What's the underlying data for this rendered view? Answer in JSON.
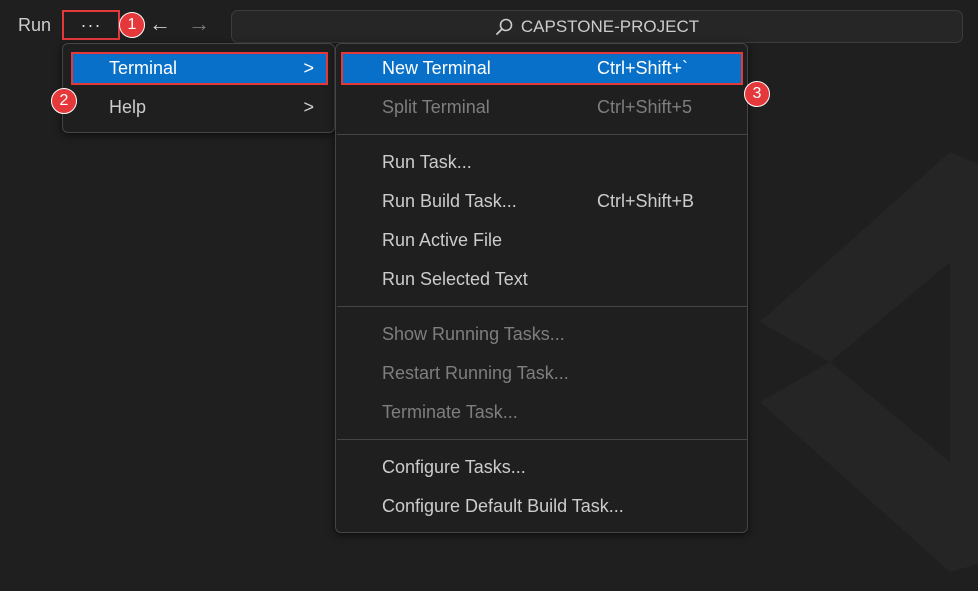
{
  "titlebar": {
    "menu_label": "Run",
    "more_label": "···",
    "back_icon": "←",
    "forward_icon": "→",
    "search_text": "CAPSTONE-PROJECT"
  },
  "menu_primary": {
    "items": [
      {
        "label": "Terminal",
        "chevron": ">"
      },
      {
        "label": "Help",
        "chevron": ">"
      }
    ]
  },
  "menu_terminal": {
    "items": [
      {
        "label": "New Terminal",
        "shortcut": "Ctrl+Shift+`",
        "enabled": true
      },
      {
        "label": "Split Terminal",
        "shortcut": "Ctrl+Shift+5",
        "enabled": false
      },
      {
        "label": "Run Task...",
        "shortcut": "",
        "enabled": true
      },
      {
        "label": "Run Build Task...",
        "shortcut": "Ctrl+Shift+B",
        "enabled": true
      },
      {
        "label": "Run Active File",
        "shortcut": "",
        "enabled": true
      },
      {
        "label": "Run Selected Text",
        "shortcut": "",
        "enabled": true
      },
      {
        "label": "Show Running Tasks...",
        "shortcut": "",
        "enabled": false
      },
      {
        "label": "Restart Running Task...",
        "shortcut": "",
        "enabled": false
      },
      {
        "label": "Terminate Task...",
        "shortcut": "",
        "enabled": false
      },
      {
        "label": "Configure Tasks...",
        "shortcut": "",
        "enabled": true
      },
      {
        "label": "Configure Default Build Task...",
        "shortcut": "",
        "enabled": true
      }
    ]
  },
  "callouts": [
    "1",
    "2",
    "3"
  ],
  "colors": {
    "highlight": "#0870c9",
    "callout": "#e5383b",
    "background": "#1f1f1f"
  }
}
